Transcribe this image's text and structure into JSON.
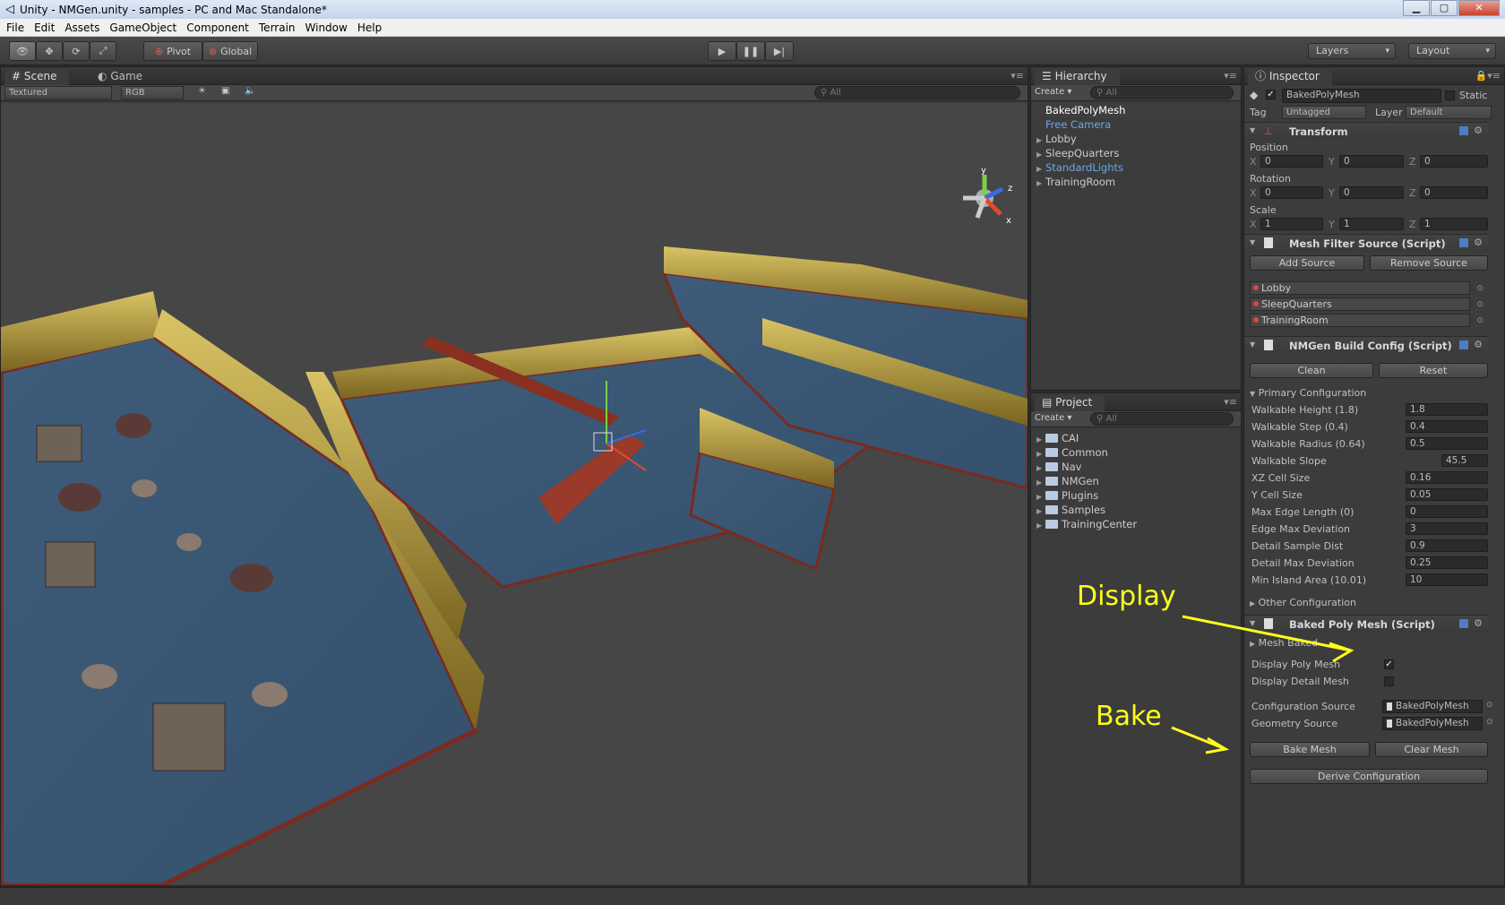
{
  "window": {
    "title": "Unity - NMGen.unity - samples - PC and Mac Standalone*"
  },
  "menu": [
    "File",
    "Edit",
    "Assets",
    "GameObject",
    "Component",
    "Terrain",
    "Window",
    "Help"
  ],
  "toolbar": {
    "pivot": "Pivot",
    "global": "Global",
    "layers": "Layers",
    "layout": "Layout"
  },
  "scene": {
    "tab_scene": "Scene",
    "tab_game": "Game",
    "render_mode": "Textured",
    "color_mode": "RGB",
    "search_placeholder": "All",
    "gizmo": {
      "y": "y",
      "z": "z",
      "x": "x"
    }
  },
  "hierarchy": {
    "tab": "Hierarchy",
    "create": "Create",
    "search_placeholder": "All",
    "items": [
      "BakedPolyMesh",
      "Free Camera",
      "Lobby",
      "SleepQuarters",
      "StandardLights",
      "TrainingRoom"
    ]
  },
  "project": {
    "tab": "Project",
    "create": "Create",
    "search_placeholder": "All",
    "folders": [
      "CAI",
      "Common",
      "Nav",
      "NMGen",
      "Plugins",
      "Samples",
      "TrainingCenter"
    ]
  },
  "inspector": {
    "tab": "Inspector",
    "object_name": "BakedPolyMesh",
    "static_label": "Static",
    "tag_label": "Tag",
    "tag_value": "Untagged",
    "layer_label": "Layer",
    "layer_value": "Default",
    "transform": {
      "title": "Transform",
      "position_label": "Position",
      "rotation_label": "Rotation",
      "scale_label": "Scale",
      "axis_x": "X",
      "axis_y": "Y",
      "axis_z": "Z",
      "position": [
        "0",
        "0",
        "0"
      ],
      "rotation": [
        "0",
        "0",
        "0"
      ],
      "scale": [
        "1",
        "1",
        "1"
      ]
    },
    "mesh_filter": {
      "title": "Mesh Filter Source (Script)",
      "add": "Add Source",
      "remove": "Remove Source",
      "sources": [
        "Lobby",
        "SleepQuarters",
        "TrainingRoom"
      ]
    },
    "build_config": {
      "title": "NMGen Build Config (Script)",
      "clean": "Clean",
      "reset": "Reset",
      "primary": "Primary Configuration",
      "params": [
        {
          "label": "Walkable Height  (1.8)",
          "value": "1.8"
        },
        {
          "label": "Walkable Step  (0.4)",
          "value": "0.4"
        },
        {
          "label": "Walkable Radius  (0.64)",
          "value": "0.5"
        },
        {
          "label": "Walkable Slope",
          "value": "45.5"
        },
        {
          "label": "XZ Cell Size",
          "value": "0.16"
        },
        {
          "label": "Y Cell Size",
          "value": "0.05"
        },
        {
          "label": "Max Edge Length  (0)",
          "value": "0"
        },
        {
          "label": "Edge Max Deviation",
          "value": "3"
        },
        {
          "label": "Detail Sample Dist",
          "value": "0.9"
        },
        {
          "label": "Detail Max Deviation",
          "value": "0.25"
        },
        {
          "label": "Min Island Area  (10.01)",
          "value": "10"
        }
      ],
      "other": "Other Configuration"
    },
    "baked": {
      "title": "Baked Poly Mesh (Script)",
      "mesh_baked": "Mesh Baked",
      "display_poly": "Display Poly Mesh",
      "display_detail": "Display Detail Mesh",
      "config_source_label": "Configuration Source",
      "config_source": "BakedPolyMesh",
      "geom_source_label": "Geometry Source",
      "geom_source": "BakedPolyMesh",
      "bake": "Bake Mesh",
      "clear": "Clear Mesh",
      "derive": "Derive Configuration"
    }
  },
  "annotations": {
    "display": "Display",
    "bake": "Bake"
  },
  "colors": {
    "annotation": "#ffff1a",
    "floor": "#3b5673",
    "wall": "#c9b055",
    "edge": "#7a2a1e"
  }
}
